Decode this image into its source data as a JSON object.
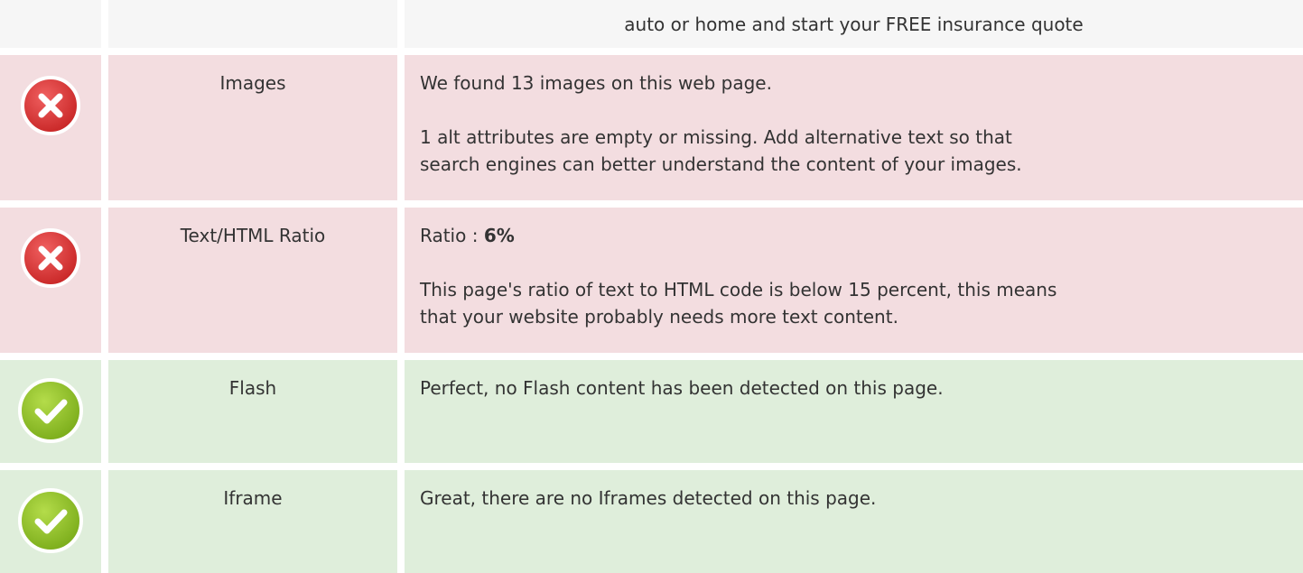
{
  "top_row": {
    "text": "auto or home and start your FREE insurance quote"
  },
  "rows": [
    {
      "status": "error",
      "icon": "error-x-icon",
      "label": "Images",
      "lines": [
        "We found 13 images on this web page.",
        "1 alt attributes are empty or missing. Add alternative text so that",
        "search engines can better understand the content of your images."
      ]
    },
    {
      "status": "error",
      "icon": "error-x-icon",
      "label": "Text/HTML Ratio",
      "ratio_prefix": "Ratio : ",
      "ratio_value": "6%",
      "lines": [
        "This page's ratio of text to HTML code is below 15 percent, this means",
        "that your website probably needs more text content."
      ]
    },
    {
      "status": "ok",
      "icon": "check-icon",
      "label": "Flash",
      "lines": [
        "Perfect, no Flash content has been detected on this page."
      ]
    },
    {
      "status": "ok",
      "icon": "check-icon",
      "label": "Iframe",
      "lines": [
        "Great, there are no Iframes detected on this page."
      ]
    }
  ],
  "colors": {
    "error_bg": "#f3dde0",
    "ok_bg": "#dfeedb",
    "neutral_bg": "#f6f6f6",
    "error_icon": "#d92e2e",
    "ok_icon": "#8fc12a"
  }
}
